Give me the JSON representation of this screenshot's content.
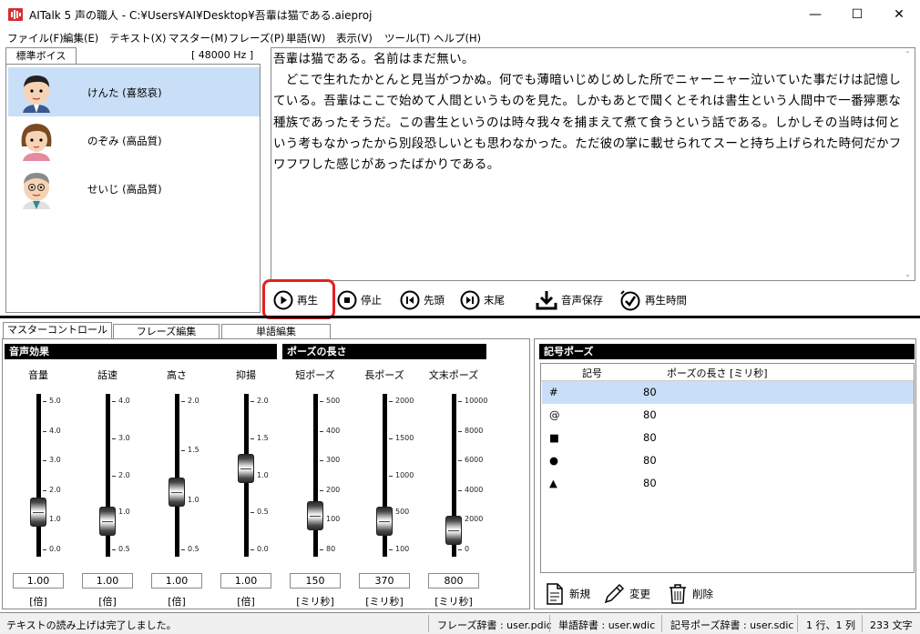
{
  "window": {
    "title": "AITalk 5 声の職人 - C:¥Users¥AI¥Desktop¥吾輩は猫である.aieproj",
    "minimize": "—",
    "maximize": "☐",
    "close": "✕"
  },
  "menu": [
    "ファイル(F)",
    "編集(E)",
    "テキスト(X)",
    "マスター(M)",
    "フレーズ(P)",
    "単語(W)",
    "表示(V)",
    "ツール(T)",
    "ヘルプ(H)"
  ],
  "voice_panel": {
    "tab": "標準ボイス",
    "sample_rate": "[ 48000 Hz ]",
    "voices": [
      {
        "name": "けんた (喜怒哀)",
        "selected": true
      },
      {
        "name": "のぞみ (高品質)",
        "selected": false
      },
      {
        "name": "せいじ (高品質)",
        "selected": false
      }
    ]
  },
  "editor": {
    "text": "吾輩は猫である。名前はまだ無い。\n　どこで生れたかとんと見当がつかぬ。何でも薄暗いじめじめした所でニャーニャー泣いていた事だけは記憶している。吾輩はここで始めて人間というものを見た。しかもあとで聞くとそれは書生という人間中で一番獰悪な種族であったそうだ。この書生というのは時々我々を捕まえて煮て食うという話である。しかしその当時は何という考もなかったから別段恐しいとも思わなかった。ただ彼の掌に載せられてスーと持ち上げられた時何だかフワフワした感じがあったばかりである。"
  },
  "toolbar": {
    "play": "再生",
    "stop": "停止",
    "head": "先頭",
    "tail": "末尾",
    "save_audio": "音声保存",
    "play_time": "再生時間"
  },
  "control_tabs": [
    "マスターコントロール",
    "フレーズ編集",
    "単語編集"
  ],
  "sections": {
    "effects": "音声効果",
    "pause_length": "ポーズの長さ",
    "symbol_pause": "記号ポーズ"
  },
  "sliders": [
    {
      "label": "音量",
      "value": "1.00",
      "unit": "[倍]",
      "ticks": [
        "5.0",
        "4.0",
        "3.0",
        "2.0",
        "1.0",
        "0.0"
      ],
      "level": 0.2
    },
    {
      "label": "話速",
      "value": "1.00",
      "unit": "[倍]",
      "ticks": [
        "4.0",
        "3.0",
        "2.0",
        "1.0",
        "0.5"
      ],
      "level": 0.14
    },
    {
      "label": "高さ",
      "value": "1.00",
      "unit": "[倍]",
      "ticks": [
        "2.0",
        "1.5",
        "1.0",
        "0.5"
      ],
      "level": 0.34
    },
    {
      "label": "抑揚",
      "value": "1.00",
      "unit": "[倍]",
      "ticks": [
        "2.0",
        "1.5",
        "1.0",
        "0.5",
        "0.0"
      ],
      "level": 0.5
    },
    {
      "label": "短ポーズ",
      "value": "150",
      "unit": "[ミリ秒]",
      "ticks": [
        "500",
        "400",
        "300",
        "200",
        "100",
        "80"
      ],
      "level": 0.18
    },
    {
      "label": "長ポーズ",
      "value": "370",
      "unit": "[ミリ秒]",
      "ticks": [
        "2000",
        "1500",
        "1000",
        "500",
        "100"
      ],
      "level": 0.14
    },
    {
      "label": "文末ポーズ",
      "value": "800",
      "unit": "[ミリ秒]",
      "ticks": [
        "10000",
        "8000",
        "6000",
        "4000",
        "2000",
        "0"
      ],
      "level": 0.08
    }
  ],
  "symbol_table": {
    "headers": [
      "記号",
      "ポーズの長さ [ミリ秒]"
    ],
    "rows": [
      {
        "symbol": "#",
        "length": "80"
      },
      {
        "symbol": "@",
        "length": "80"
      },
      {
        "symbol": "■",
        "length": "80"
      },
      {
        "symbol": "●",
        "length": "80"
      },
      {
        "symbol": "▲",
        "length": "80"
      }
    ],
    "buttons": {
      "new": "新規",
      "edit": "変更",
      "delete": "削除"
    }
  },
  "status": {
    "message": "テキストの読み上げは完了しました。",
    "phrase_dict": "フレーズ辞書 : user.pdic",
    "word_dict": "単語辞書 : user.wdic",
    "symbol_dict": "記号ポーズ辞書 : user.sdic",
    "position": "1 行、1 列",
    "char_count": "233 文字"
  },
  "colors": {
    "selection": "#c9dff7",
    "highlight": "#e32020"
  }
}
